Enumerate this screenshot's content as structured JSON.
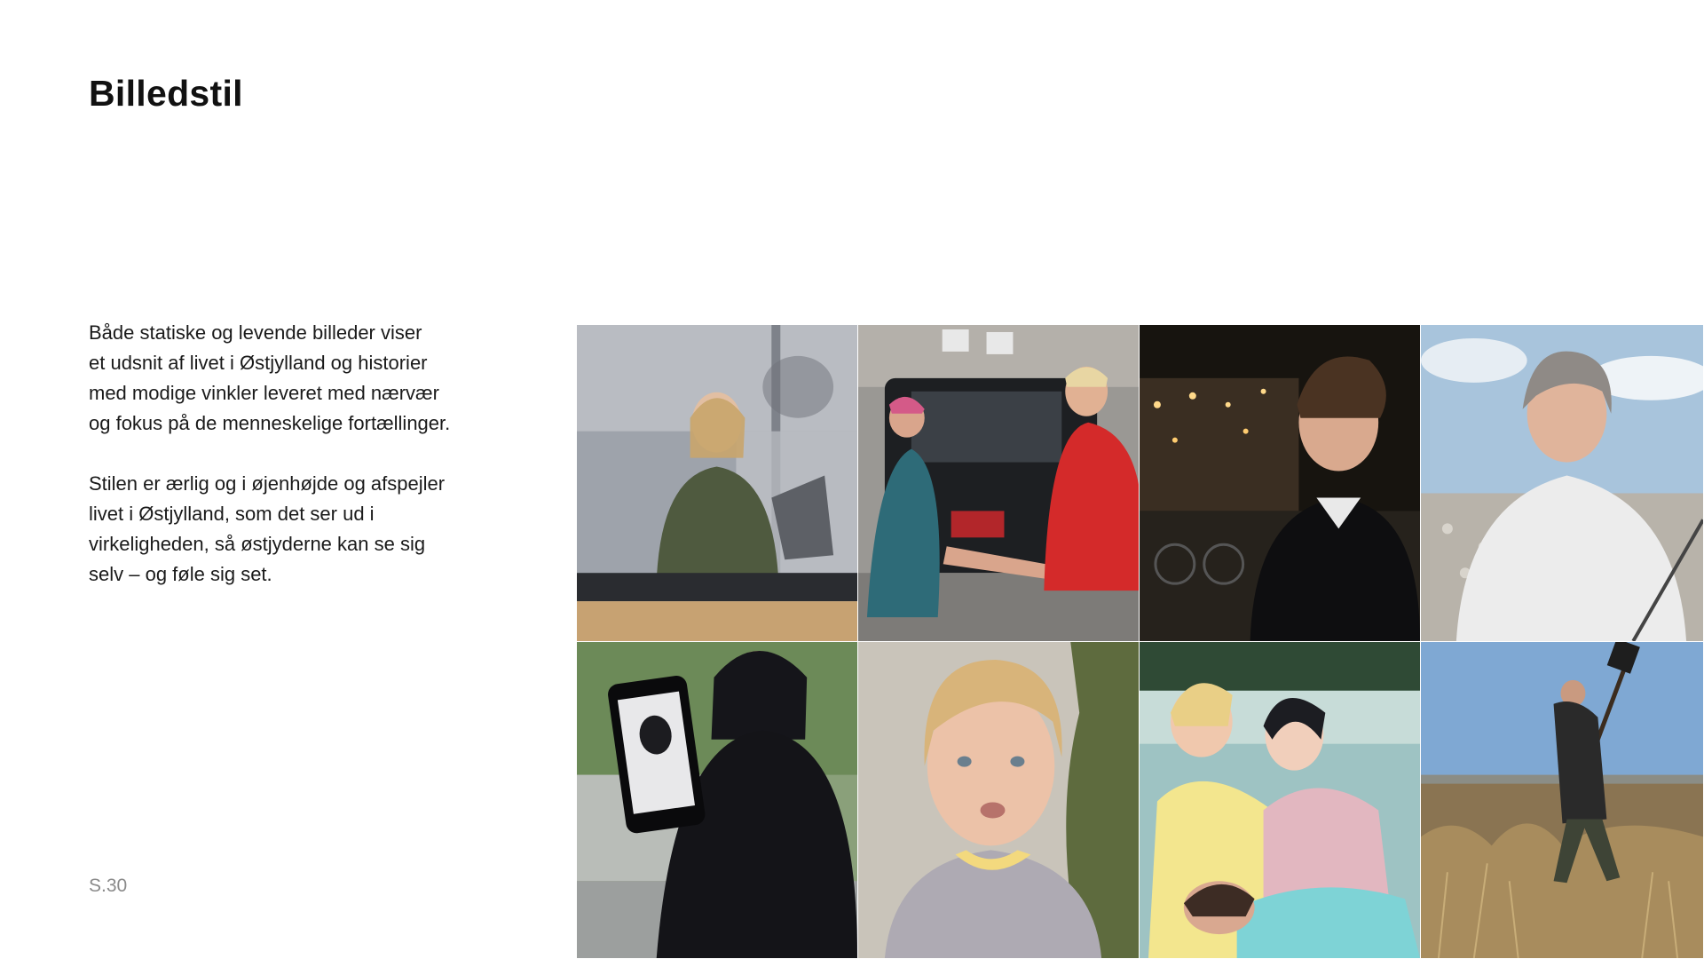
{
  "title": "Billedstil",
  "paragraphs": [
    "Både statiske og levende billeder viser\net udsnit af livet i Østjylland og historier\nmed modige vinkler leveret med nærvær\nog fokus på de menneskelige fortællinger.",
    "Stilen er ærlig og i øjenhøjde og afspejler\nlivet i Østjylland, som det ser ud i\nvirkeligheden, så østjyderne kan se sig\nselv – og føle sig set."
  ],
  "page_number": "S.30",
  "photos": [
    {
      "subject": "news-anchor-in-studio"
    },
    {
      "subject": "two-people-by-car"
    },
    {
      "subject": "young-man-night-street"
    },
    {
      "subject": "older-woman-by-sea"
    },
    {
      "subject": "woman-showing-phone"
    },
    {
      "subject": "girl-speaking-portrait"
    },
    {
      "subject": "people-in-blankets-by-lake"
    },
    {
      "subject": "man-digging-in-field"
    }
  ]
}
